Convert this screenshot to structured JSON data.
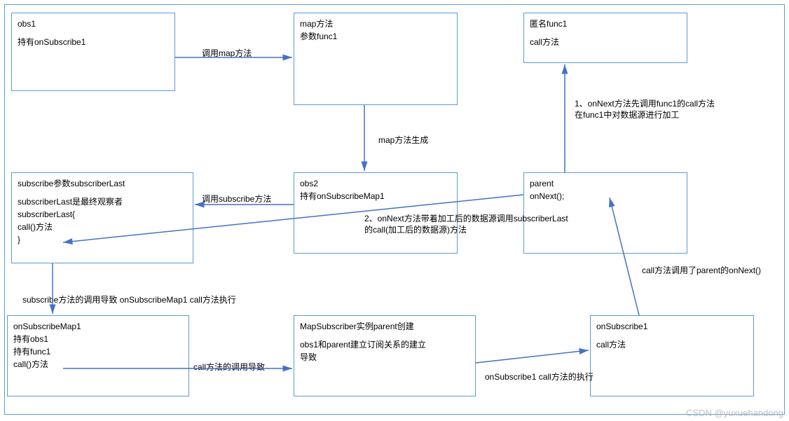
{
  "boxes": {
    "obs1": {
      "title": "obs1",
      "line1": "持有onSubscribe1"
    },
    "map": {
      "title": "map方法",
      "line1": "参数func1"
    },
    "func1": {
      "title": "匿名func1",
      "line1": "call方法"
    },
    "obs2": {
      "title": "obs2",
      "line1": "持有onSubscribeMap1"
    },
    "parent": {
      "title": "parent",
      "line1": "onNext();"
    },
    "subLast": {
      "title": "subscribe参数subscriberLast",
      "line1": "subscriberLast是最终观察者",
      "line2": "subscriberLast{",
      "line3": "call()方法",
      "line4": "}"
    },
    "onSubMap1": {
      "title": "onSubscribeMap1",
      "line1": "持有obs1",
      "line2": "持有func1",
      "line3": "call()方法"
    },
    "mapSub": {
      "title": "MapSubscriber实例parent创建",
      "line1": "obs1和parent建立订阅关系的建立",
      "line2": "导致"
    },
    "onSub1": {
      "title": "onSubscribe1",
      "line1": "call方法"
    }
  },
  "labels": {
    "callMap": "调用map方法",
    "mapGen": "map方法生成",
    "callSubscribe": "调用subscribe方法",
    "note1a": "1、onNext方法先调用func1的call方法",
    "note1b": "在func1中对数据源进行加工",
    "note2a": "2、onNext方法带着加工后的数据源调用subscriberLast",
    "note2b": "的call(加工后的数据源)方法",
    "subCause": "subscribe方法的调用导致 onSubscribeMap1 call方法执行",
    "callCause": "call方法的调用导致",
    "onSub1Exec": "onSubscribe1 call方法的执行",
    "callParent": "call方法调用了parent的onNext()"
  },
  "watermark": "CSDN @yuxuehandong"
}
